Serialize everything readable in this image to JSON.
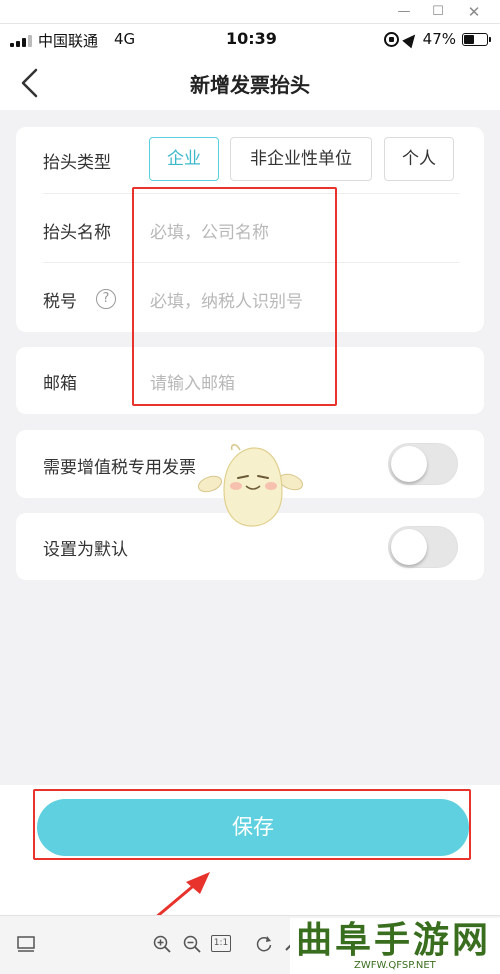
{
  "status_bar": {
    "carrier": "中国联通",
    "network": "4G",
    "time": "10:39",
    "battery": "47%"
  },
  "header": {
    "title": "新增发票抬头"
  },
  "form": {
    "type_label": "抬头类型",
    "type_options": [
      "企业",
      "非企业性单位",
      "个人"
    ],
    "selected_type": "企业",
    "name_label": "抬头名称",
    "name_placeholder": "必填，公司名称",
    "tax_label": "税号",
    "tax_help_icon": "?",
    "tax_placeholder": "必填，纳税人识别号",
    "email_label": "邮箱",
    "email_placeholder": "请输入邮箱",
    "vat_label": "需要增值税专用发票",
    "vat_enabled": false,
    "default_label": "设置为默认",
    "default_enabled": false
  },
  "actions": {
    "save_label": "保存"
  },
  "viewer_toolbar": {
    "fit_label": "1:1"
  },
  "watermark": {
    "text": "曲阜手游网",
    "url": "ZWFW.QFSP.NET"
  },
  "colors": {
    "accent": "#5fd0df",
    "annotation_red": "#e8332c"
  }
}
